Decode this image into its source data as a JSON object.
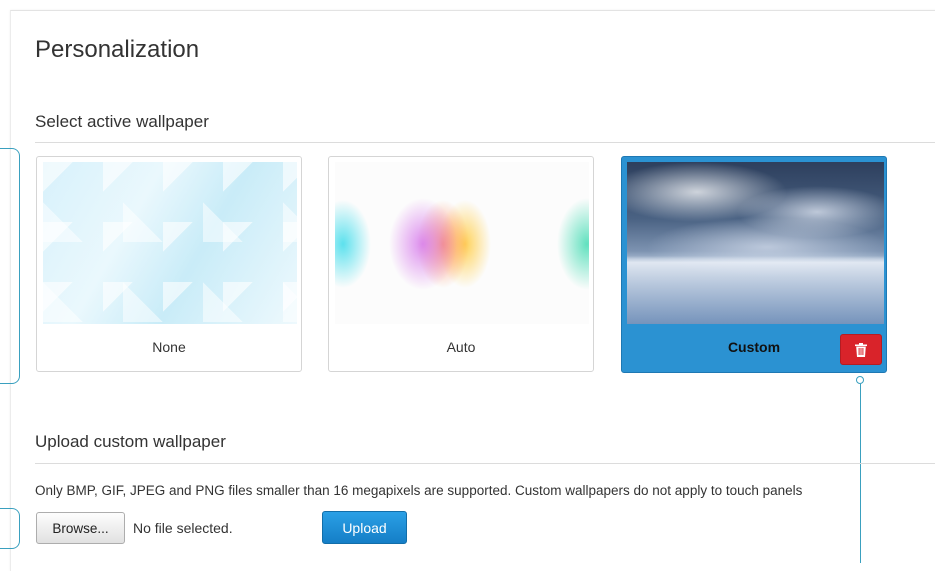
{
  "page": {
    "title": "Personalization"
  },
  "wallpaper": {
    "section_title": "Select active wallpaper",
    "options": [
      {
        "label": "None",
        "active": false
      },
      {
        "label": "Auto",
        "active": false
      },
      {
        "label": "Custom",
        "active": true
      }
    ],
    "delete_icon": "trash-icon"
  },
  "upload": {
    "section_title": "Upload custom wallpaper",
    "info_text": "Only BMP, GIF, JPEG and PNG files smaller than 16 megapixels are supported. Custom wallpapers do not apply to touch panels",
    "browse_label": "Browse...",
    "file_status": "No file selected.",
    "upload_label": "Upload"
  },
  "colors": {
    "accent": "#2b92d2",
    "danger": "#d9232a",
    "callout": "#3aa0bf"
  }
}
